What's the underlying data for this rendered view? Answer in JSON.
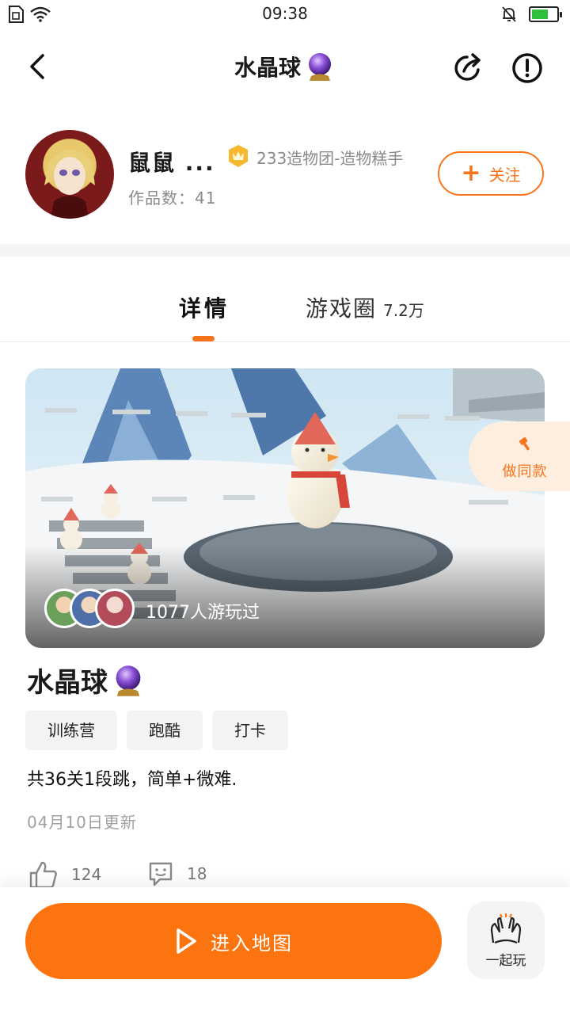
{
  "status_bar": {
    "time": "09:38"
  },
  "header": {
    "title": "水晶球"
  },
  "author": {
    "name": "鼠鼠 ...",
    "works": "作品数：41",
    "badge": "233造物团-造物糕手",
    "follow_label": "关注"
  },
  "tabs": [
    {
      "label": "详情"
    },
    {
      "label": "游戏圈",
      "count": "7.2万"
    }
  ],
  "cover": {
    "played": "1077人游玩过",
    "make_same": "做同款"
  },
  "game": {
    "title": "水晶球",
    "tags": [
      "训练营",
      "跑酷",
      "打卡"
    ],
    "description": "共36关1段跳，简单+微难.",
    "updated": "04月10日更新"
  },
  "stats": {
    "likes": "124",
    "comments": "18"
  },
  "bottom": {
    "enter_label": "进入地图",
    "play_together_label": "一起玩"
  },
  "colors": {
    "accent": "#f7741a",
    "button": "#fb740f"
  }
}
